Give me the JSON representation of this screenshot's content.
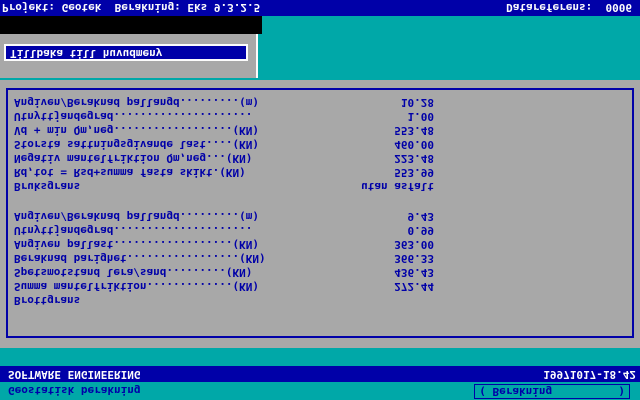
{
  "header": {
    "project": "Projekt: Geotek  Berakning: Eks 9.3.2.5",
    "reference": "Datareferens:  0006"
  },
  "menu": {
    "back_label": "Tillbaka till huvudmeny"
  },
  "rows": [
    {
      "label": "Angiven/Beraknad pallangd.........(m)",
      "value": "10.28"
    },
    {
      "label": "Utnyttjandegrad.....................",
      "value": "1.00"
    },
    {
      "label": "Vd + min Qm,neg..................(KN)",
      "value": "553.48"
    },
    {
      "label": "Storsta sattningsgivande last....(KN)",
      "value": "460.00"
    },
    {
      "label": "Negativ mantelfriktion Qm,neg...(KN)",
      "value": "223.48"
    },
    {
      "label": "Rd,tot = Rsd+summa fasta skikt.(KN)",
      "value": "553.99"
    },
    {
      "label": "Bruksgrans",
      "value": "utan asfalt"
    },
    {
      "label": "Angiven/Beraknad pallangd.........(m)",
      "value": "9.43"
    },
    {
      "label": "Utnyttjandegrad.....................",
      "value": "0.99"
    },
    {
      "label": "Angiven pallast..................(KN)",
      "value": "363.00"
    },
    {
      "label": "Beraknad barighet.................(KN)",
      "value": "366.33"
    },
    {
      "label": "Spetsmotstand lera/sand.........(KN)",
      "value": "436.43"
    },
    {
      "label": "Summa mantelfriktion.............(KN)",
      "value": "272.44"
    },
    {
      "label": "Brottgrans",
      "value": ""
    }
  ],
  "footer": {
    "company": "SOFTWARE ENGINEERING",
    "timestamp": "19971017-18.42",
    "program": "Geostatisk berakning",
    "status": "( Berakning          )"
  },
  "colors": {
    "background": "#00a8a8",
    "blue": "#0000a8",
    "panel": "#a8a8a8",
    "white": "#fcfcfc"
  }
}
